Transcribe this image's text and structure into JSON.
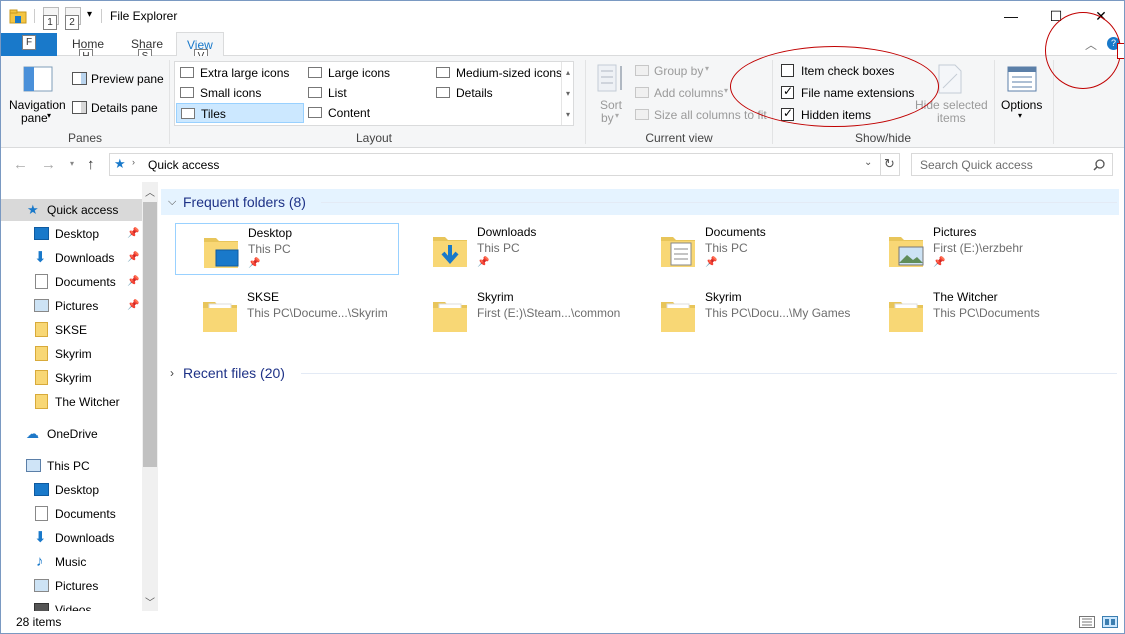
{
  "window": {
    "title": "File Explorer",
    "controls": {
      "minimize": "—",
      "maximize": "☐",
      "close": "✕"
    }
  },
  "keytips": {
    "quick1": "1",
    "quick2": "2",
    "file": "F",
    "home": "H",
    "share": "S",
    "view": "V"
  },
  "ribbon_tabs": {
    "file": "",
    "home": "Home",
    "share": "Share",
    "view": "View",
    "active": "View"
  },
  "ribbon": {
    "panes": {
      "group_label": "Panes",
      "navigation_pane": "Navigation",
      "navigation_pane_2": "pane",
      "preview_pane": "Preview pane",
      "details_pane": "Details pane"
    },
    "layout": {
      "group_label": "Layout",
      "items": [
        "Extra large icons",
        "Large icons",
        "Medium-sized icons",
        "Small icons",
        "List",
        "Details",
        "Tiles",
        "Content"
      ],
      "selected": "Tiles"
    },
    "current_view": {
      "group_label": "Current view",
      "sort_by": "Sort",
      "sort_by_2": "by",
      "group_by": "Group by",
      "add_columns": "Add columns",
      "size_all_columns": "Size all columns to fit"
    },
    "show_hide": {
      "group_label": "Show/hide",
      "item_check_boxes": "Item check boxes",
      "item_check_boxes_checked": false,
      "file_name_extensions": "File name extensions",
      "file_name_extensions_checked": true,
      "hidden_items": "Hidden items",
      "hidden_items_checked": true,
      "hide_selected_items": "Hide selected",
      "hide_selected_items_2": "items"
    },
    "options": {
      "label": "Options"
    }
  },
  "address_bar": {
    "path": "Quick access",
    "search_placeholder": "Search Quick access"
  },
  "nav_pane": {
    "quick_access": "Quick access",
    "quick_items": [
      "Desktop",
      "Downloads",
      "Documents",
      "Pictures",
      "SKSE",
      "Skyrim",
      "Skyrim",
      "The Witcher"
    ],
    "onedrive": "OneDrive",
    "this_pc": "This PC",
    "pc_items": [
      "Desktop",
      "Documents",
      "Downloads",
      "Music",
      "Pictures",
      "Videos"
    ]
  },
  "content": {
    "frequent_header": "Frequent folders (8)",
    "recent_header": "Recent files (20)",
    "folders": [
      {
        "name": "Desktop",
        "sub": "This PC",
        "pinned": true
      },
      {
        "name": "Downloads",
        "sub": "This PC",
        "pinned": true
      },
      {
        "name": "Documents",
        "sub": "This PC",
        "pinned": true
      },
      {
        "name": "Pictures",
        "sub": "First (E:)\\erzbehr",
        "pinned": true
      },
      {
        "name": "SKSE",
        "sub": "This PC\\Docume...\\Skyrim",
        "pinned": false
      },
      {
        "name": "Skyrim",
        "sub": "First (E:)\\Steam...\\common",
        "pinned": false
      },
      {
        "name": "Skyrim",
        "sub": "This PC\\Docu...\\My Games",
        "pinned": false
      },
      {
        "name": "The Witcher",
        "sub": "This PC\\Documents",
        "pinned": false
      }
    ]
  },
  "status_bar": {
    "item_count": "28 items"
  },
  "colors": {
    "accent": "#1979ca",
    "annotation": "#c00000",
    "selection": "#cce8ff"
  }
}
